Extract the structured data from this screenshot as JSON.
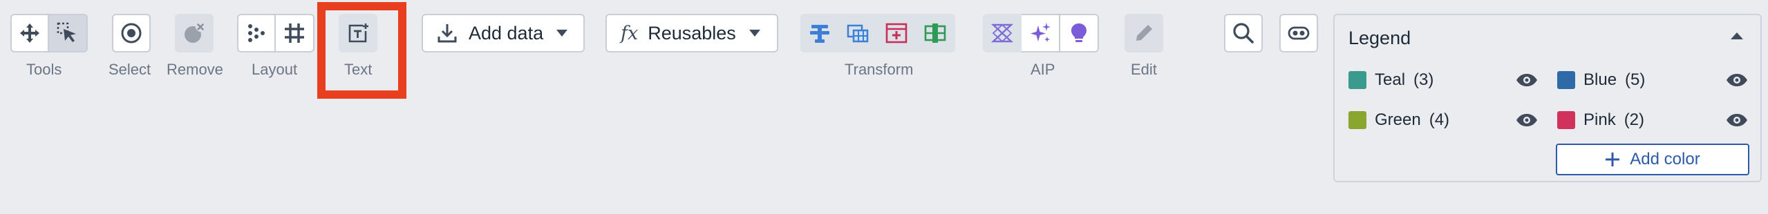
{
  "toolbar": {
    "tools_label": "Tools",
    "select_label": "Select",
    "remove_label": "Remove",
    "layout_label": "Layout",
    "text_label": "Text",
    "add_data_label": "Add data",
    "reusables_label": "Reusables",
    "reusables_icon_text": "fx",
    "transform_label": "Transform",
    "aip_label": "AIP",
    "edit_label": "Edit"
  },
  "legend": {
    "title": "Legend",
    "items": [
      {
        "name": "Teal",
        "count": "(3)",
        "color": "#3a9a8e"
      },
      {
        "name": "Blue",
        "count": "(5)",
        "color": "#2f6aa8"
      },
      {
        "name": "Green",
        "count": "(4)",
        "color": "#8aa62f"
      },
      {
        "name": "Pink",
        "count": "(2)",
        "color": "#d0325c"
      }
    ],
    "add_color_label": "Add color"
  },
  "icons": {
    "tools": [
      "move-icon",
      "pointer-icon"
    ],
    "select": "target-icon",
    "remove": "remove-node-icon",
    "layout": [
      "scatter-layout-icon",
      "grid-layout-icon"
    ],
    "text": "text-box-icon",
    "transform": [
      "filter-icon",
      "table-icon",
      "add-panel-icon",
      "split-icon"
    ],
    "aip": [
      "hourglass-icon",
      "sparkle-icon",
      "bulb-icon"
    ],
    "edit": "pencil-icon",
    "search": "search-icon",
    "toggle": "toggle-icon"
  }
}
